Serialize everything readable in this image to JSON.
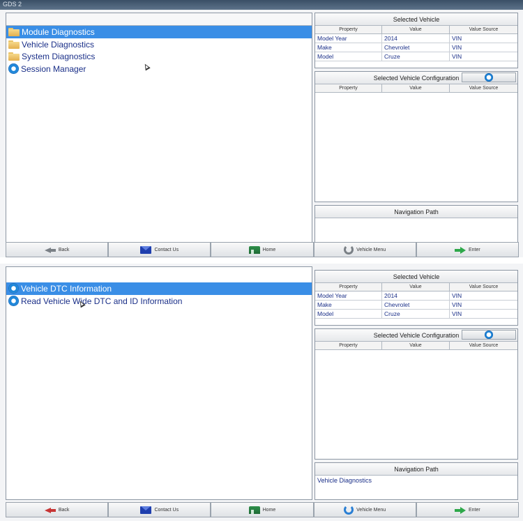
{
  "top": {
    "window_title": "GDS 2",
    "tree": [
      {
        "label": "Module Diagnostics",
        "icon": "folder-icon",
        "selected": true
      },
      {
        "label": "Vehicle Diagnostics",
        "icon": "folder-icon",
        "selected": false
      },
      {
        "label": "System Diagnostics",
        "icon": "folder-icon",
        "selected": false
      },
      {
        "label": "Session Manager",
        "icon": "gear-icon",
        "selected": false
      }
    ],
    "navigation_path_value": ""
  },
  "bottom": {
    "tree": [
      {
        "label": "Vehicle DTC Information",
        "icon": "gear-icon",
        "selected": true
      },
      {
        "label": "Read Vehicle Wide DTC and ID Information",
        "icon": "gear-icon",
        "selected": false
      }
    ],
    "navigation_path_value": "Vehicle Diagnostics"
  },
  "selected_vehicle": {
    "title": "Selected Vehicle",
    "columns": [
      "Property",
      "Value",
      "Value Source"
    ],
    "rows": [
      [
        "Model Year",
        "2014",
        "VIN"
      ],
      [
        "Make",
        "Chevrolet",
        "VIN"
      ],
      [
        "Model",
        "Cruze",
        "VIN"
      ]
    ]
  },
  "vehicle_config": {
    "title": "Selected Vehicle Configuration",
    "columns": [
      "Property",
      "Value",
      "Value Source"
    ]
  },
  "navigation_path": {
    "title": "Navigation Path"
  },
  "buttons": {
    "back": "Back",
    "contact": "Contact Us",
    "home": "Home",
    "vehicle_menu": "Vehicle Menu",
    "enter": "Enter"
  },
  "colors": {
    "selection": "#3a8ee6",
    "tree_text": "#1a2f88",
    "table_text": "#1a2f88"
  }
}
